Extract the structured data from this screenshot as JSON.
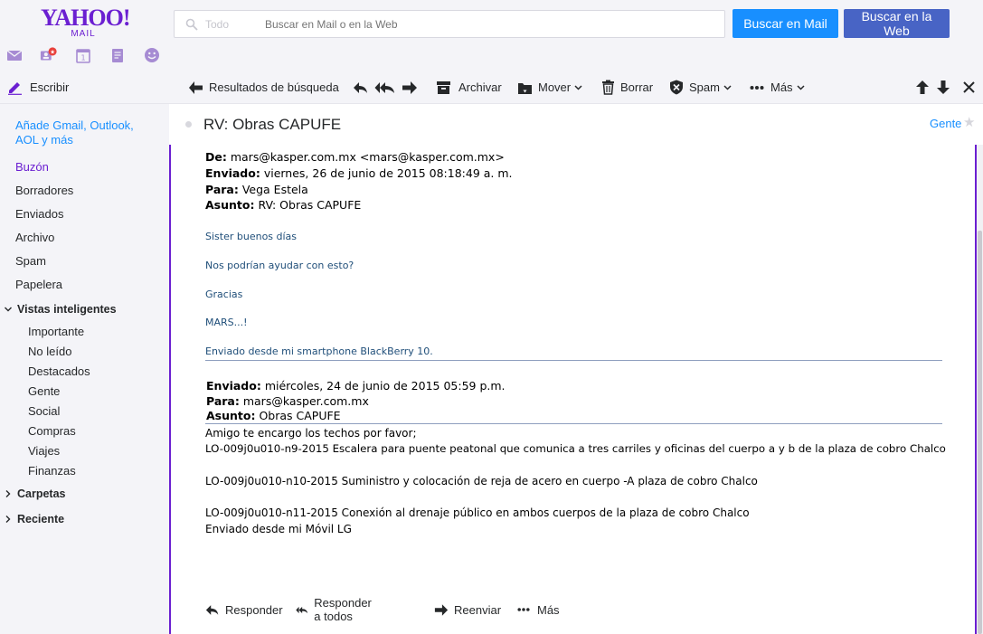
{
  "header": {
    "logo_main": "YAHOO!",
    "logo_sub": "MAIL",
    "search_scope": "Todo",
    "search_placeholder": "Buscar en Mail o en la Web",
    "btn_search_mail": "Buscar en Mail",
    "btn_search_web": "Buscar en la Web",
    "app_icons": [
      "mail-icon",
      "contacts-icon",
      "calendar-icon",
      "notepad-icon",
      "messenger-icon"
    ]
  },
  "toolbar": {
    "compose": "Escribir",
    "back_results": "Resultados de búsqueda",
    "archive": "Archivar",
    "move": "Mover",
    "delete": "Borrar",
    "spam": "Spam",
    "more": "Más"
  },
  "sidebar": {
    "promo": "Añade Gmail, Outlook, AOL y más",
    "folders": [
      "Buzón",
      "Borradores",
      "Enviados",
      "Archivo",
      "Spam",
      "Papelera"
    ],
    "smart_views_title": "Vistas inteligentes",
    "smart_views": [
      "Importante",
      "No leído",
      "Destacados",
      "Gente",
      "Social",
      "Compras",
      "Viajes",
      "Finanzas"
    ],
    "folders_title": "Carpetas",
    "recent_title": "Reciente"
  },
  "message": {
    "subject": "RV: Obras CAPUFE",
    "people_link": "Gente",
    "fwd1": {
      "from_label": "De:",
      "from_value": "mars@kasper.com.mx <mars@kasper.com.mx>",
      "sent_label": "Enviado:",
      "sent_value": "viernes, 26 de junio de 2015 08:18:49 a. m.",
      "to_label": "Para:",
      "to_value": "Vega Estela",
      "subject_label": "Asunto:",
      "subject_value": "RV: Obras CAPUFE"
    },
    "blue_lines": [
      "Sister buenos días",
      "Nos podrían ayudar con esto?",
      "Gracias",
      "MARS...!",
      "Enviado desde mi smartphone BlackBerry 10."
    ],
    "fwd2": {
      "sent_label": "Enviado:",
      "sent_value": "miércoles, 24 de junio de 2015 05:59 p.m.",
      "to_label": "Para:",
      "to_value": "mars@kasper.com.mx",
      "subject_label": "Asunto:",
      "subject_value": "Obras CAPUFE"
    },
    "body_lines": [
      "Amigo te encargo los techos por favor;",
      "LO-009j0u010-n9-2015   Escalera para puente peatonal que comunica a tres carriles y oficinas del cuerpo a y b de la plaza de cobro Chalco",
      "LO-009j0u010-n10-2015    Suministro y colocación de reja de acero en cuerpo -A plaza de cobro Chalco",
      "LO-009j0u010-n11-2015      Conexión al drenaje público en ambos cuerpos de la plaza de cobro Chalco",
      "Enviado desde mi Móvil LG"
    ],
    "actions": {
      "reply": "Responder",
      "reply_all": "Responder a todos",
      "forward": "Reenviar",
      "more": "Más"
    }
  },
  "colors": {
    "brand_purple": "#6b1fd1",
    "search_mail_blue": "#188fff",
    "search_web_blue": "#4864c5",
    "link_blue": "#188fff",
    "quote_blue": "#1f4e79"
  }
}
